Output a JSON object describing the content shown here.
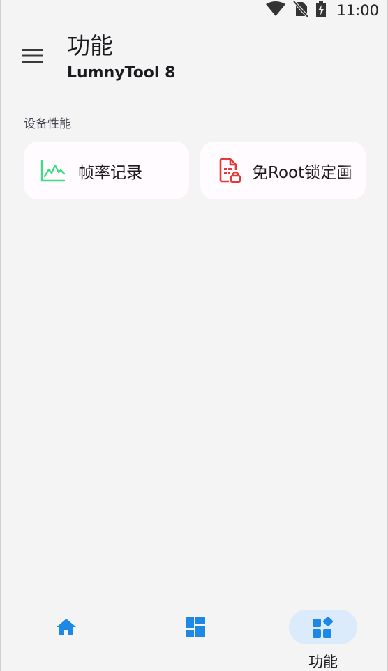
{
  "status_bar": {
    "time": "11:00",
    "icons": [
      "wifi-icon",
      "no-sim-icon",
      "battery-charging-icon"
    ]
  },
  "app_bar": {
    "menu_icon": "hamburger-menu-icon",
    "title": "功能",
    "subtitle": "LumnyTool 8"
  },
  "section": {
    "label": "设备性能",
    "cards": [
      {
        "label": "帧率记录",
        "icon": "line-chart-icon",
        "icon_color": "#3ddc84"
      },
      {
        "label": "免Root锁定画",
        "icon": "document-lock-icon",
        "icon_color": "#e53935"
      }
    ]
  },
  "bottom_nav": {
    "items": [
      {
        "name": "home",
        "icon": "home-icon",
        "label": ""
      },
      {
        "name": "dashboard",
        "icon": "dashboard-icon",
        "label": ""
      },
      {
        "name": "functions",
        "icon": "widgets-icon",
        "label": "功能",
        "selected": true
      }
    ],
    "accent_color": "#1e88e5",
    "selected_pill_color": "#dcebfb"
  }
}
